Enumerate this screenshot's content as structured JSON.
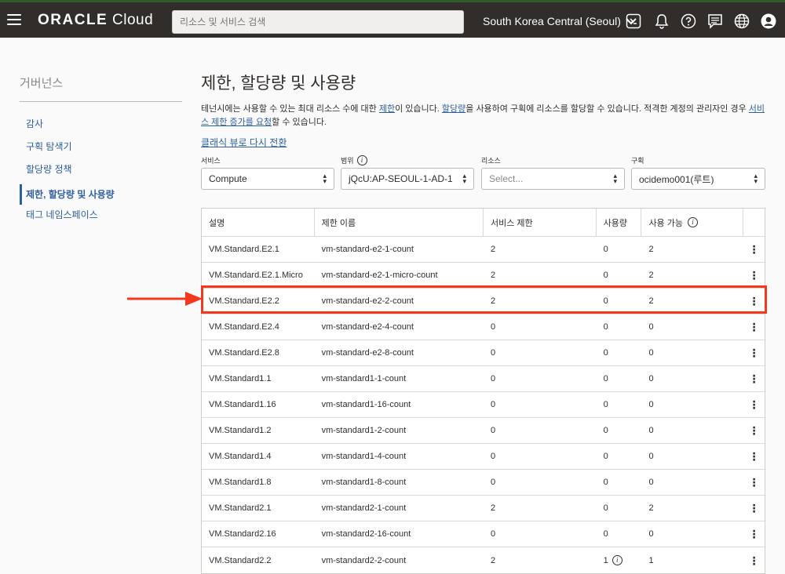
{
  "header": {
    "brand_bold": "ORACLE",
    "brand_light": " Cloud",
    "search_placeholder": "리소스 및 서비스 검색",
    "region": "South Korea Central (Seoul)"
  },
  "sidebar": {
    "title": "거버넌스",
    "items": [
      {
        "label": "감사"
      },
      {
        "label": "구획 탐색기"
      },
      {
        "label": "할당량 정책"
      },
      {
        "label": "제한, 할당량 및 사용량"
      },
      {
        "label": "태그 네임스페이스"
      }
    ]
  },
  "main": {
    "title": "제한, 할당량 및 사용량",
    "desc_1": "테넌시에는 사용할 수 있는 최대 리소스 수에 대한 ",
    "desc_link_1": "제한",
    "desc_2": "이 있습니다. ",
    "desc_link_2": "할당량",
    "desc_3": "을 사용하여 구획에 리소스를 할당할 수 있습니다. 적격한 계정의 관리자인 경우 ",
    "desc_link_3": "서비스 제한 증가를 요청",
    "desc_4": "할 수 있습니다.",
    "classic_link": "클래식 뷰로 다시 전환"
  },
  "filters": {
    "service_label": "서비스",
    "service_value": "Compute",
    "scope_label": "범위",
    "scope_value": "jQcU:AP-SEOUL-1-AD-1",
    "resource_label": "리소스",
    "resource_placeholder": "Select...",
    "compartment_label": "구획",
    "compartment_value": "ocidemo001(루트)"
  },
  "table": {
    "headers": [
      "설명",
      "제한 이름",
      "서비스 제한",
      "사용량",
      "사용 가능"
    ],
    "rows": [
      [
        "VM.Standard.E2.1",
        "vm-standard-e2-1-count",
        "2",
        "0",
        "2"
      ],
      [
        "VM.Standard.E2.1.Micro",
        "vm-standard-e2-1-micro-count",
        "2",
        "0",
        "2"
      ],
      [
        "VM.Standard.E2.2",
        "vm-standard-e2-2-count",
        "2",
        "0",
        "2"
      ],
      [
        "VM.Standard.E2.4",
        "vm-standard-e2-4-count",
        "0",
        "0",
        "0"
      ],
      [
        "VM.Standard.E2.8",
        "vm-standard-e2-8-count",
        "0",
        "0",
        "0"
      ],
      [
        "VM.Standard1.1",
        "vm-standard1-1-count",
        "0",
        "0",
        "0"
      ],
      [
        "VM.Standard1.16",
        "vm-standard1-16-count",
        "0",
        "0",
        "0"
      ],
      [
        "VM.Standard1.2",
        "vm-standard1-2-count",
        "0",
        "0",
        "0"
      ],
      [
        "VM.Standard1.4",
        "vm-standard1-4-count",
        "0",
        "0",
        "0"
      ],
      [
        "VM.Standard1.8",
        "vm-standard1-8-count",
        "0",
        "0",
        "0"
      ],
      [
        "VM.Standard2.1",
        "vm-standard2-1-count",
        "2",
        "0",
        "2"
      ],
      [
        "VM.Standard2.16",
        "vm-standard2-16-count",
        "0",
        "0",
        "0"
      ],
      [
        "VM.Standard2.2",
        "vm-standard2-2-count",
        "2",
        "1",
        "1"
      ]
    ],
    "highlighted_row": "VM.Standard.E2.2",
    "info_icon_row": "VM.Standard2.2"
  },
  "colors": {
    "topbar": "#312d2a",
    "link": "#2d5f9e",
    "highlight": "#f4381e"
  }
}
